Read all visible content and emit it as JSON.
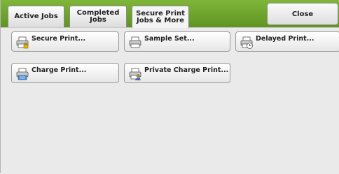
{
  "tabs": [
    {
      "label": "Active Jobs"
    },
    {
      "label": "Completed\nJobs"
    },
    {
      "label": "Secure Print\nJobs & More"
    }
  ],
  "close_label": "Close",
  "functions": {
    "secure_print": "Secure Print...",
    "sample_set": "Sample Set...",
    "delayed_print": "Delayed Print...",
    "charge_print": "Charge Print...",
    "private_charge_print": "Private Charge Print..."
  }
}
